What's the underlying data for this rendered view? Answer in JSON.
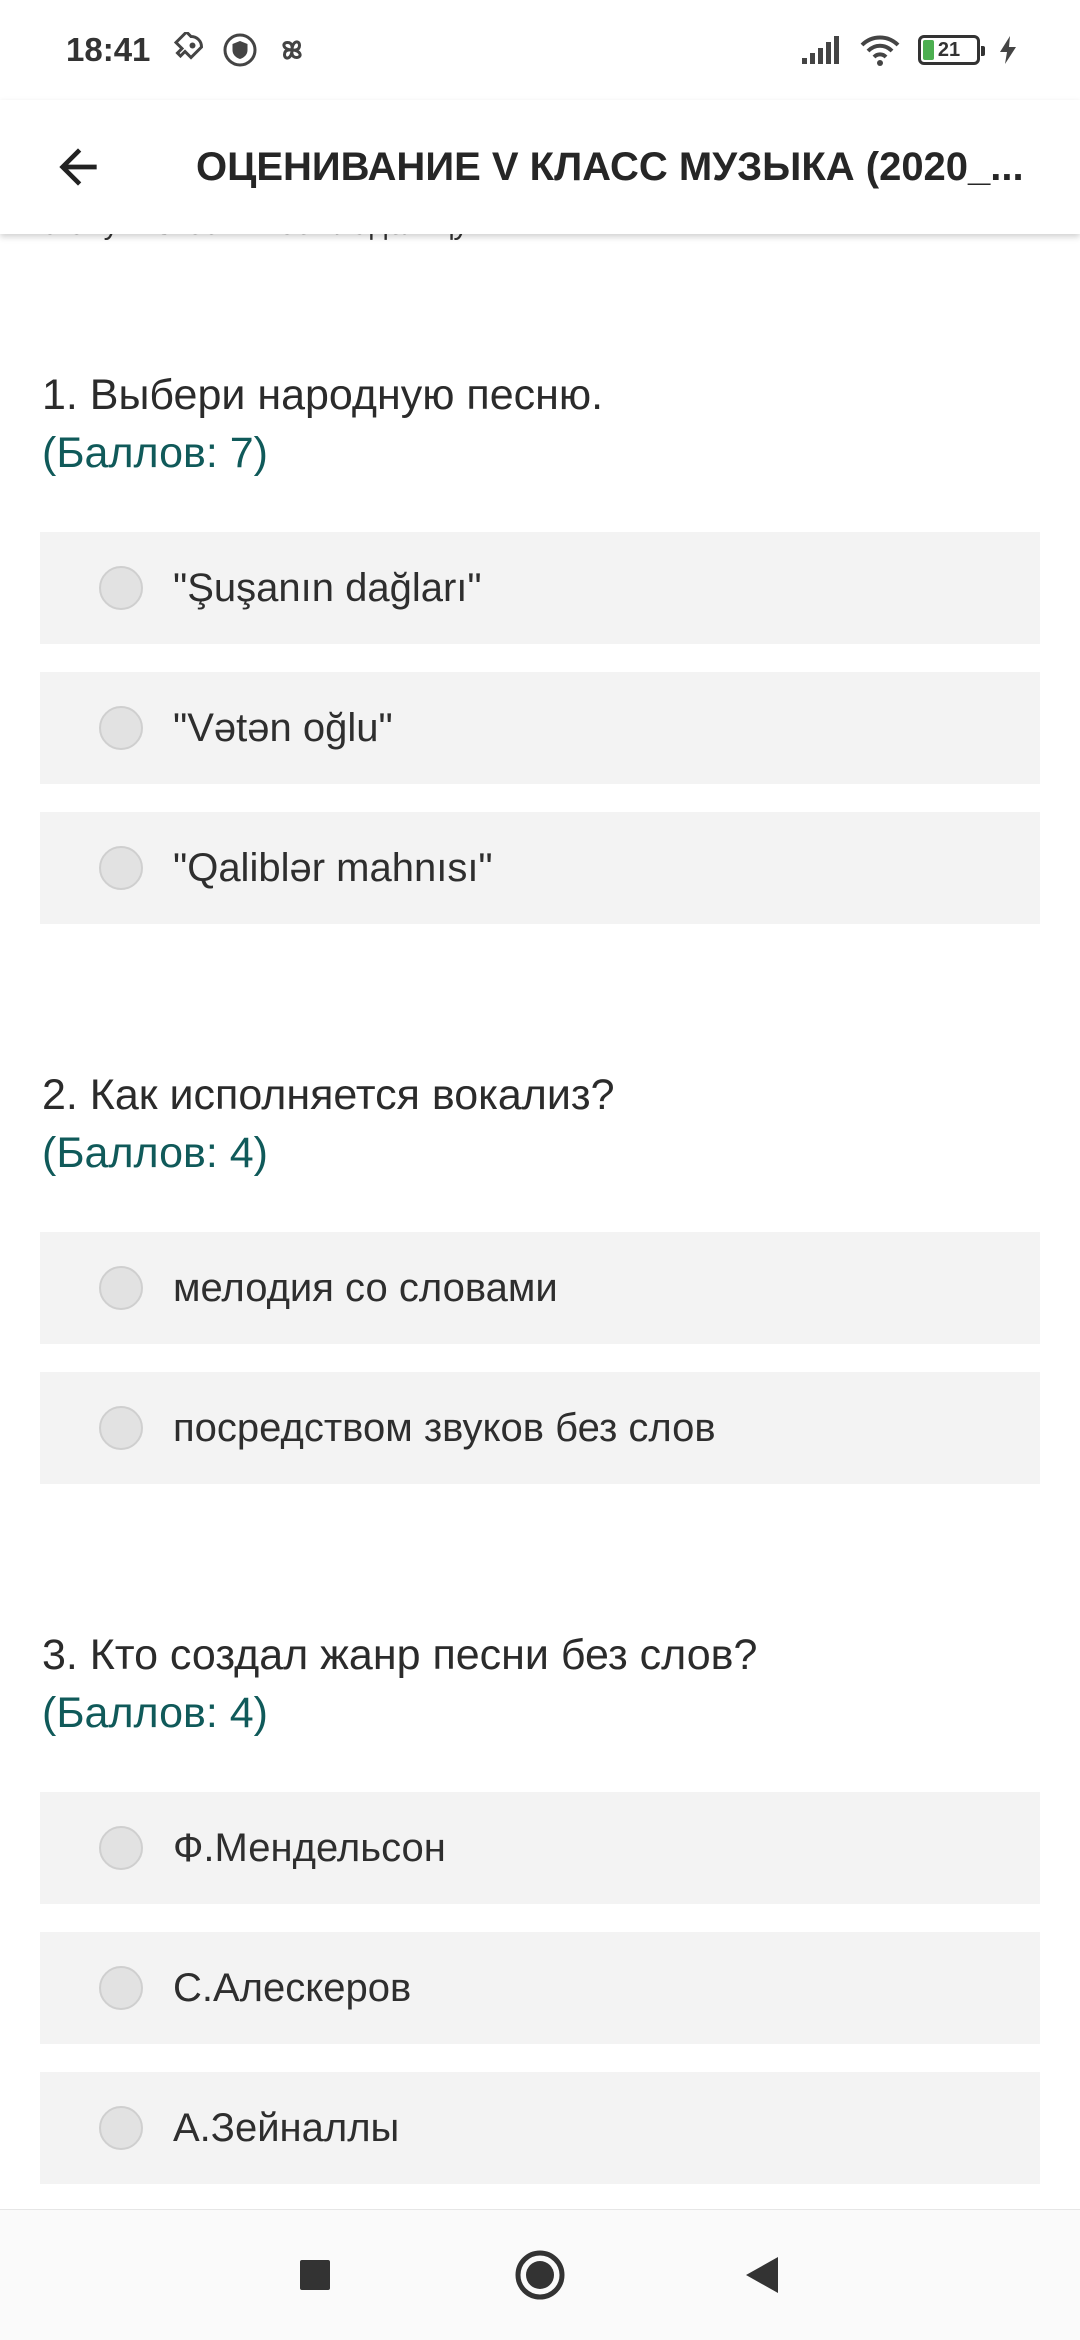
{
  "status_bar": {
    "time": "18:41",
    "battery_level": "21",
    "battery_fill_fraction": 0.21,
    "icons": [
      "rocket-icon",
      "vpn-shield-icon",
      "pinwheel-icon",
      "signal-icon",
      "wifi-icon",
      "battery-icon",
      "charging-icon"
    ]
  },
  "app_bar": {
    "title": "ОЦЕНИВАНИЕ  V КЛАСС МУЗЫКА (2020_...",
    "back_icon": "arrow-left-icon"
  },
  "intro_text": "станут известны ее владельцу.",
  "questions": [
    {
      "text": "1. Выбери народную песню.",
      "points": "(Баллов: 7)",
      "options": [
        "\"Şuşanın dağları\"",
        "\"Vətən oğlu\"",
        "\"Qaliblər mahnısı\""
      ]
    },
    {
      "text": "2. Как исполняется вокализ?",
      "points": "(Баллов: 4)",
      "options": [
        "мелодия со словами",
        "посредством звуков без слов"
      ]
    },
    {
      "text": "3. Кто создал жанр песни без слов?",
      "points": "(Баллов: 4)",
      "options": [
        "Ф.Мендельсон",
        "С.Алескеров",
        "А.Зейналлы"
      ]
    }
  ],
  "nav_bar": {
    "icons": [
      "recents-square-icon",
      "home-circle-icon",
      "back-triangle-icon"
    ]
  },
  "colors": {
    "points": "#105a5a",
    "option_bg": "#f3f3f3",
    "battery": "#4caf50"
  }
}
